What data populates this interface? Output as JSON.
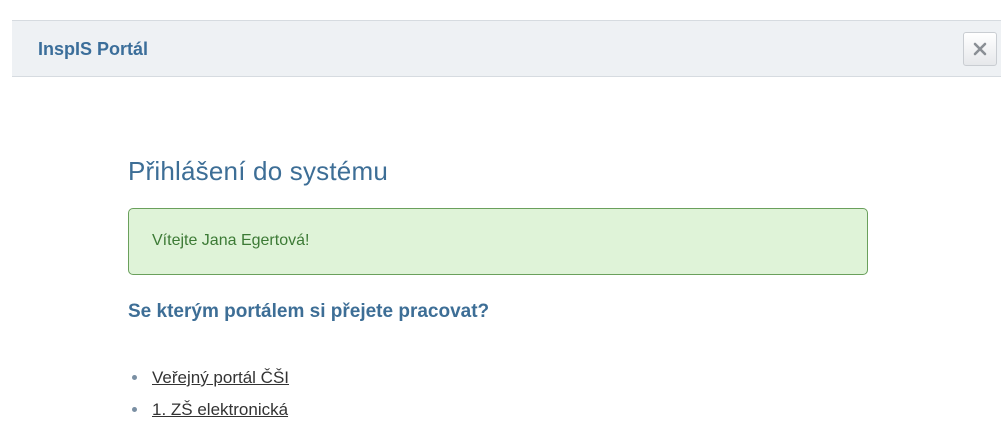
{
  "header": {
    "title": "InspIS Portál"
  },
  "content": {
    "heading": "Přihlášení do systému",
    "welcome_message": "Vítejte Jana Egertová!",
    "question": "Se kterým portálem si přejete pracovat?",
    "portals": [
      {
        "label": "Veřejný portál ČŠI"
      },
      {
        "label": "1. ZŠ elektronická"
      }
    ]
  },
  "icons": {
    "close": "close-icon",
    "bullet": "bullet-icon"
  },
  "colors": {
    "accent": "#3d6e96",
    "alert_bg": "#dff3d8",
    "alert_border": "#6aa05c",
    "alert_text": "#3c7a35",
    "titlebar_bg": "#eef1f4"
  }
}
